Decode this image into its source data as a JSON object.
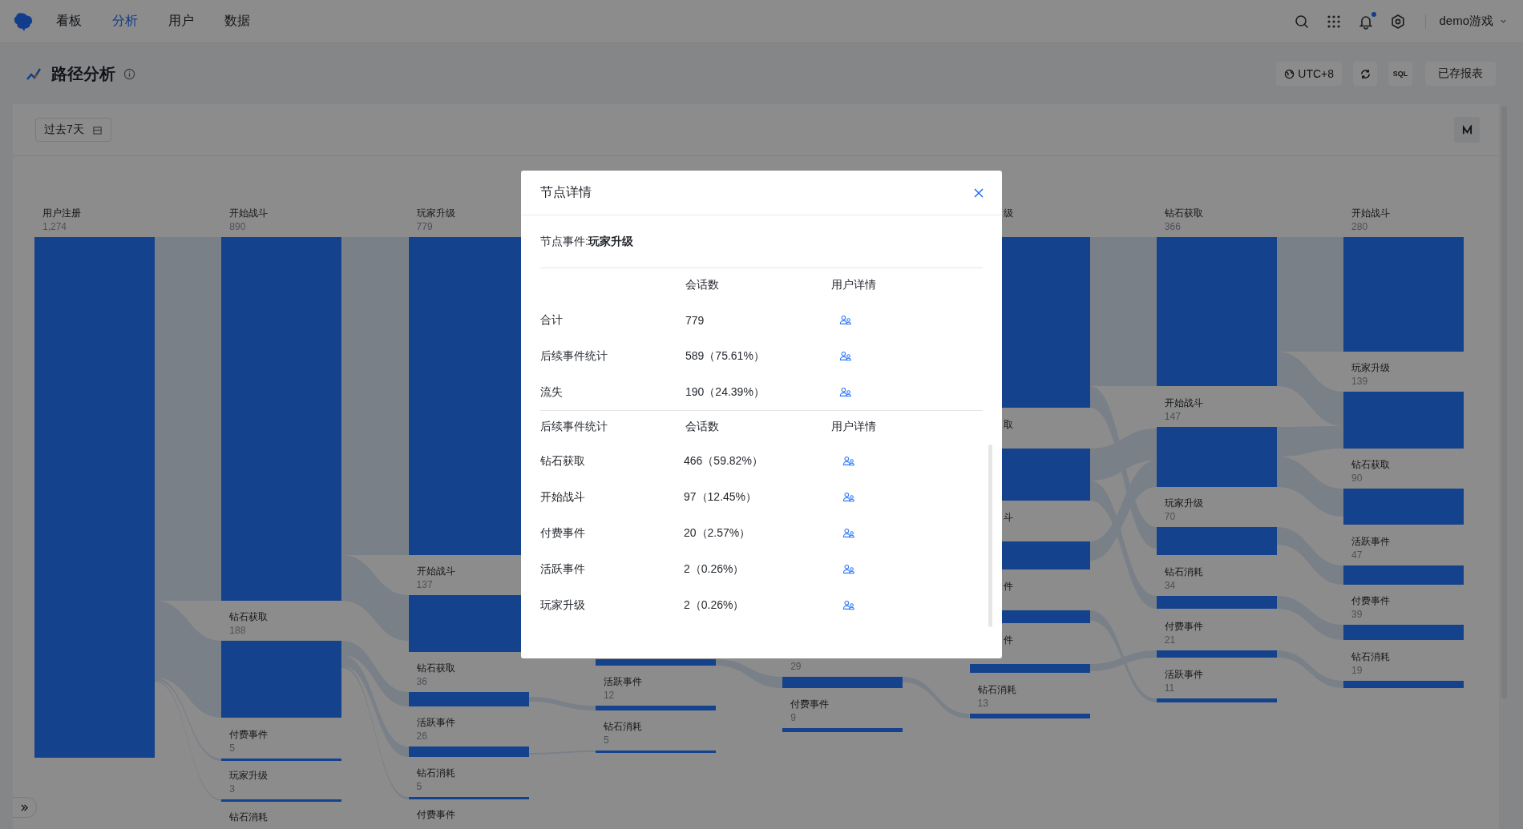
{
  "nav": {
    "tabs": [
      {
        "label": "看板",
        "selected": false
      },
      {
        "label": "分析",
        "selected": true
      },
      {
        "label": "用户",
        "selected": false
      },
      {
        "label": "数据",
        "selected": false
      }
    ],
    "notification_dot": true,
    "project": "demo游戏"
  },
  "header": {
    "title": "路径分析",
    "actions": [
      {
        "kind": "timezone",
        "label": "UTC+8"
      },
      {
        "kind": "refresh"
      },
      {
        "kind": "sql",
        "label": "SQL"
      },
      {
        "kind": "text",
        "label": "已存报表"
      }
    ]
  },
  "filter": {
    "date_range": "过去7天"
  },
  "sankey": {
    "columns": [
      {
        "nodes": [
          {
            "kind": "node",
            "label": "用户注册",
            "count": "1,274"
          }
        ]
      },
      {
        "nodes": [
          {
            "kind": "node",
            "label": "开始战斗",
            "count": "890"
          },
          {
            "kind": "node",
            "label": "钻石获取",
            "count": "188"
          },
          {
            "kind": "node",
            "label": "付费事件",
            "count": "5"
          },
          {
            "kind": "node",
            "label": "玩家升级",
            "count": "3"
          },
          {
            "kind": "caption",
            "label": "钻石消耗"
          }
        ]
      },
      {
        "nodes": [
          {
            "kind": "node",
            "label": "玩家升级",
            "count": "779"
          },
          {
            "kind": "node",
            "label": "开始战斗",
            "count": "137"
          },
          {
            "kind": "node",
            "label": "钻石获取",
            "count": "36"
          },
          {
            "kind": "node",
            "label": "活跃事件",
            "count": "26"
          },
          {
            "kind": "node",
            "label": "钻石消耗",
            "count": "5"
          },
          {
            "kind": "caption",
            "label": "付费事件"
          }
        ]
      },
      {
        "nodes": [
          {
            "kind": "node"
          },
          {
            "kind": "node",
            "label": "活跃事件",
            "count": "12"
          },
          {
            "kind": "node",
            "label": "钻石消耗",
            "count": "5"
          }
        ]
      },
      {
        "nodes": [
          {
            "kind": "node",
            "count": "29"
          },
          {
            "kind": "node",
            "label": "付费事件",
            "count": "9"
          }
        ]
      },
      {
        "nodes": [
          {
            "kind": "node",
            "label": "级",
            "partial": true
          },
          {
            "kind": "node",
            "label": "取",
            "partial": true
          },
          {
            "kind": "node",
            "label": "斗",
            "partial": true
          },
          {
            "kind": "node",
            "label": "件",
            "partial": true
          },
          {
            "kind": "node",
            "label": "件",
            "partial": true
          },
          {
            "kind": "node",
            "label": "钻石消耗",
            "count": "13"
          }
        ]
      },
      {
        "nodes": [
          {
            "kind": "node",
            "label": "钻石获取",
            "count": "366"
          },
          {
            "kind": "node",
            "label": "开始战斗",
            "count": "147"
          },
          {
            "kind": "node",
            "label": "玩家升级",
            "count": "70"
          },
          {
            "kind": "node",
            "label": "钻石消耗",
            "count": "34"
          },
          {
            "kind": "node",
            "label": "付费事件",
            "count": "21"
          },
          {
            "kind": "node",
            "label": "活跃事件",
            "count": "11"
          }
        ]
      },
      {
        "nodes": [
          {
            "kind": "node",
            "label": "开始战斗",
            "count": "280"
          },
          {
            "kind": "node",
            "label": "玩家升级",
            "count": "139"
          },
          {
            "kind": "node",
            "label": "钻石获取",
            "count": "90"
          },
          {
            "kind": "node",
            "label": "活跃事件",
            "count": "47"
          },
          {
            "kind": "node",
            "label": "付费事件",
            "count": "39"
          },
          {
            "kind": "node",
            "label": "钻石消耗",
            "count": "19"
          }
        ]
      }
    ]
  },
  "dialog": {
    "title": "节点详情",
    "event": "节点事件:**玩家升级**",
    "summary": {
      "columns": [
        "会话数",
        "用户详情"
      ],
      "rows": [
        {
          "label": "合计",
          "sessions": "779"
        },
        {
          "label": "后续事件统计",
          "sessions": "589（75.61%）"
        },
        {
          "label": "流失",
          "sessions": "190（24.39%）"
        }
      ]
    },
    "followups": {
      "columns": [
        "后续事件统计",
        "会话数",
        "用户详情"
      ],
      "rows": [
        {
          "label": "钻石获取",
          "sessions": "466（59.82%）"
        },
        {
          "label": "开始战斗",
          "sessions": "97（12.45%）"
        },
        {
          "label": "付费事件",
          "sessions": "20（2.57%）"
        },
        {
          "label": "活跃事件",
          "sessions": "2（0.26%）"
        },
        {
          "label": "玩家升级",
          "sessions": "2（0.26%）"
        }
      ]
    }
  }
}
